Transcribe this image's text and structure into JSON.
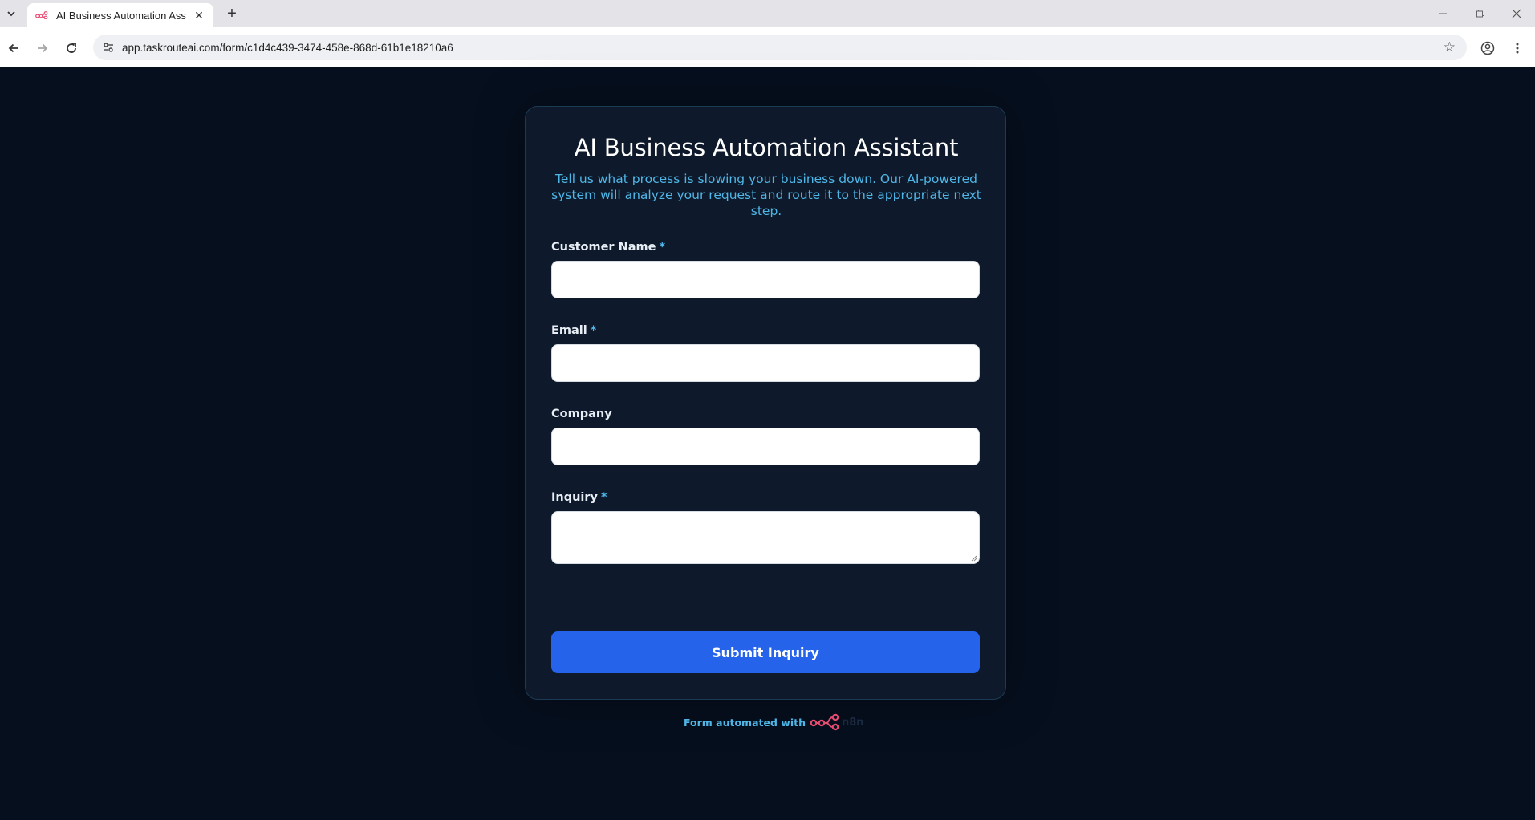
{
  "browser": {
    "tab": {
      "title": "AI Business Automation Assista",
      "favicon": "n8n-logo-icon"
    },
    "url": "app.taskrouteai.com/form/c1d4c439-3474-458e-868d-61b1e18210a6",
    "icons": {
      "tab_search": "chevron-down-icon",
      "tab_close": "close-icon",
      "new_tab": "plus-icon",
      "minimize": "minimize-icon",
      "restore": "restore-icon",
      "close_window": "close-icon",
      "back": "back-arrow-icon",
      "forward": "forward-arrow-icon",
      "reload": "reload-icon",
      "site_info": "site-info-icon",
      "bookmark": "star-icon",
      "profile": "profile-icon",
      "menu": "kebab-menu-icon"
    }
  },
  "form": {
    "title": "AI Business Automation Assistant",
    "subtitle": "Tell us what process is slowing your business down. Our AI-powered system will analyze your request and route it to the appropriate next step.",
    "fields": [
      {
        "label": "Customer Name",
        "required": "*",
        "value": ""
      },
      {
        "label": "Email",
        "required": "*",
        "value": ""
      },
      {
        "label": "Company",
        "required": "",
        "value": ""
      },
      {
        "label": "Inquiry",
        "required": "*",
        "value": ""
      }
    ],
    "submit_label": "Submit Inquiry"
  },
  "footer": {
    "text": "Form automated with",
    "logo_word": "n8n"
  },
  "colors": {
    "page_bg": "#060f1e",
    "card_bg": "#0e1a2b",
    "accent": "#4fb7e8",
    "button": "#2563eb",
    "logo": "#ea4b71"
  }
}
